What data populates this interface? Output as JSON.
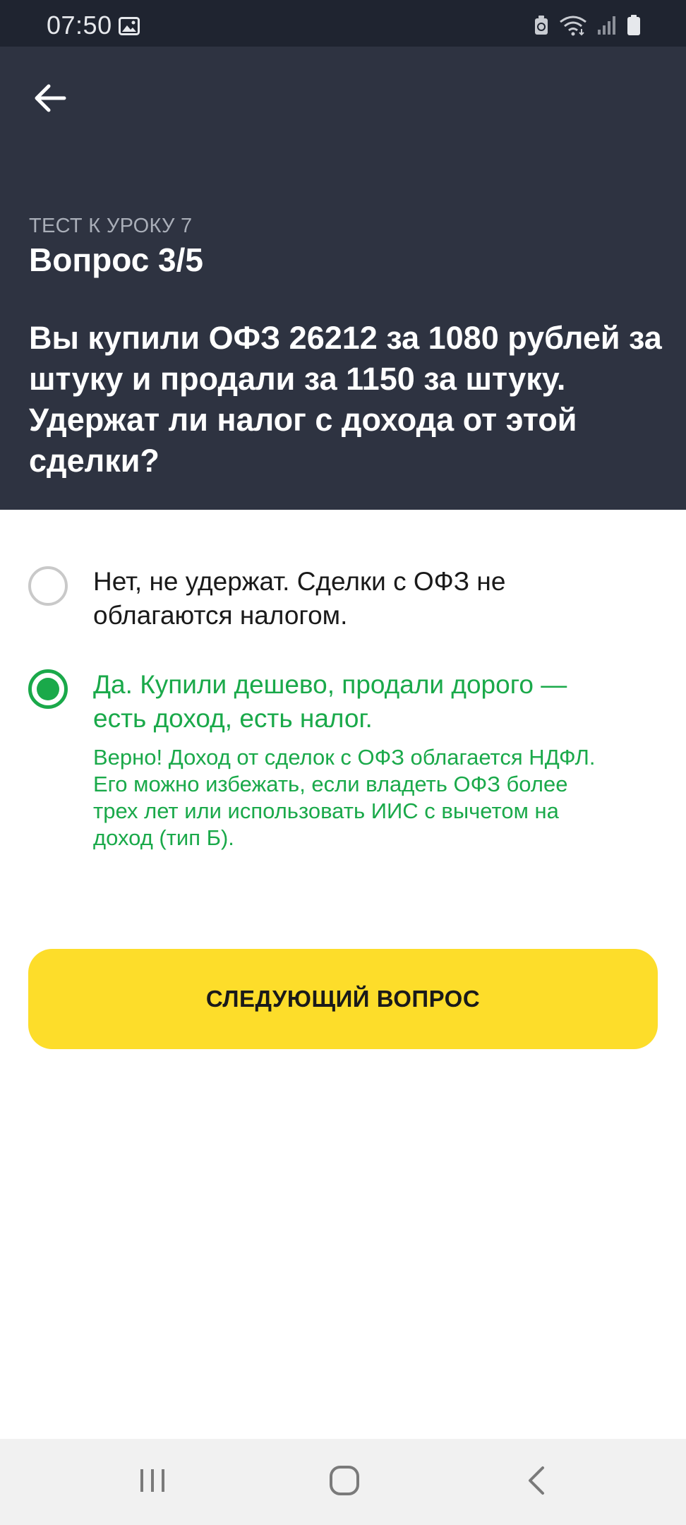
{
  "status_bar": {
    "time": "07:50",
    "icons": [
      "image-icon",
      "battery-saver-icon",
      "wifi-icon",
      "signal-icon",
      "battery-icon"
    ]
  },
  "header": {
    "back_icon": "arrow-left-icon",
    "test_label": "ТЕСТ К УРОКУ 7",
    "question_counter": "Вопрос 3/5",
    "question_text": "Вы купили ОФЗ 26212 за 1080 рублей за штуку и продали за 1150 за штуку. Удержат ли налог с дохода от этой сделки?"
  },
  "options": [
    {
      "text": "Нет, не удержат. Сделки с ОФЗ не облагаются налогом.",
      "selected": false
    },
    {
      "text": "Да. Купили дешево, продали дорого — есть доход, есть налог.",
      "selected": true,
      "feedback": "Верно! Доход от сделок с ОФЗ облагается НДФЛ. Его можно избежать, если владеть ОФЗ более трех лет или использовать ИИС с вычетом на доход (тип Б)."
    }
  ],
  "next_button": {
    "label": "СЛЕДУЮЩИЙ ВОПРОС"
  },
  "colors": {
    "header_bg": "#2e3341",
    "status_bg": "#1f2430",
    "correct_green": "#1aa94a",
    "button_yellow": "#fddd2a"
  },
  "nav_bar": {
    "icons": [
      "recent-apps-icon",
      "home-icon",
      "back-icon"
    ]
  }
}
